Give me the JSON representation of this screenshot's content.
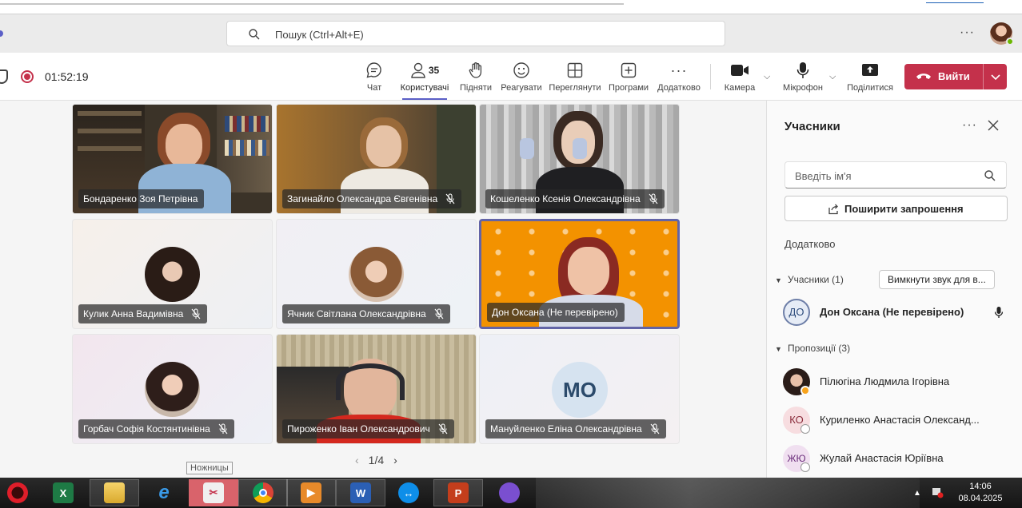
{
  "search": {
    "placeholder": "Пошук (Ctrl+Alt+E)"
  },
  "toolbar": {
    "timer": "01:52:19",
    "buttons": [
      {
        "id": "chat",
        "label": "Чат"
      },
      {
        "id": "people",
        "label": "Користувачі",
        "count": "35"
      },
      {
        "id": "raise",
        "label": "Підняти"
      },
      {
        "id": "react",
        "label": "Реагувати"
      },
      {
        "id": "view",
        "label": "Переглянути"
      },
      {
        "id": "apps",
        "label": "Програми"
      },
      {
        "id": "more",
        "label": "Додатково"
      },
      {
        "id": "camera",
        "label": "Камера"
      },
      {
        "id": "mic",
        "label": "Мікрофон"
      },
      {
        "id": "share",
        "label": "Поділитися"
      }
    ],
    "leave_label": "Вийти"
  },
  "tiles": [
    {
      "name": "Бондаренко Зоя Петрівна",
      "muted": false,
      "active": false
    },
    {
      "name": "Загинайло Олександра Євгенівна",
      "muted": true,
      "active": false
    },
    {
      "name": "Кошеленко Ксенія Олександрівна",
      "muted": true,
      "active": false
    },
    {
      "name": "Кулик Анна Вадимівна",
      "muted": true,
      "active": false
    },
    {
      "name": "Ячник Світлана Олександрівна",
      "muted": true,
      "active": false
    },
    {
      "name": "Дон Оксана (Не перевірено)",
      "muted": false,
      "active": true
    },
    {
      "name": "Горбач Софія Костянтинівна",
      "muted": true,
      "active": false
    },
    {
      "name": "Пироженко Іван Олександрович",
      "muted": true,
      "active": false
    },
    {
      "name": "Мануйленко Еліна Олександрівна",
      "muted": true,
      "active": false,
      "initials": "МО"
    }
  ],
  "pager": {
    "label": "1/4"
  },
  "tooltip": "Ножницы",
  "panel": {
    "title": "Учасники",
    "search_placeholder": "Введіть ім'я",
    "invite_label": "Поширити запрошення",
    "extra_label": "Додатково",
    "participants_group": "Учасники (1)",
    "mute_all_label": "Вимкнути звук для в...",
    "participants": [
      {
        "initials": "ДО",
        "name": "Дон Оксана (Не перевірено)"
      }
    ],
    "suggestions_group": "Пропозиції (3)",
    "suggestions": [
      {
        "initials": "",
        "name": "Пілюгіна Людмила Ігорівна",
        "status_color": "#f8a31b"
      },
      {
        "initials": "КО",
        "name": "Куриленко Анастасія Олександ...",
        "status_color": "#9a9a9a"
      },
      {
        "initials": "ЖЮ",
        "name": "Жулай Анастасія Юріївна",
        "status_color": "#9a9a9a"
      }
    ]
  },
  "taskbar": {
    "apps": [
      "opera-icon",
      "excel-icon",
      "explorer-icon",
      "internet-explorer-icon",
      "snipping-tool-icon",
      "chrome-icon",
      "media-player-icon",
      "word-icon",
      "teamviewer-icon",
      "powerpoint-icon",
      "tor-icon"
    ],
    "time": "14:06",
    "date": "08.04.2025"
  },
  "colors": {
    "accent": "#5b5fc7",
    "leave": "#c4314b",
    "pro_orange": "#f39200"
  }
}
